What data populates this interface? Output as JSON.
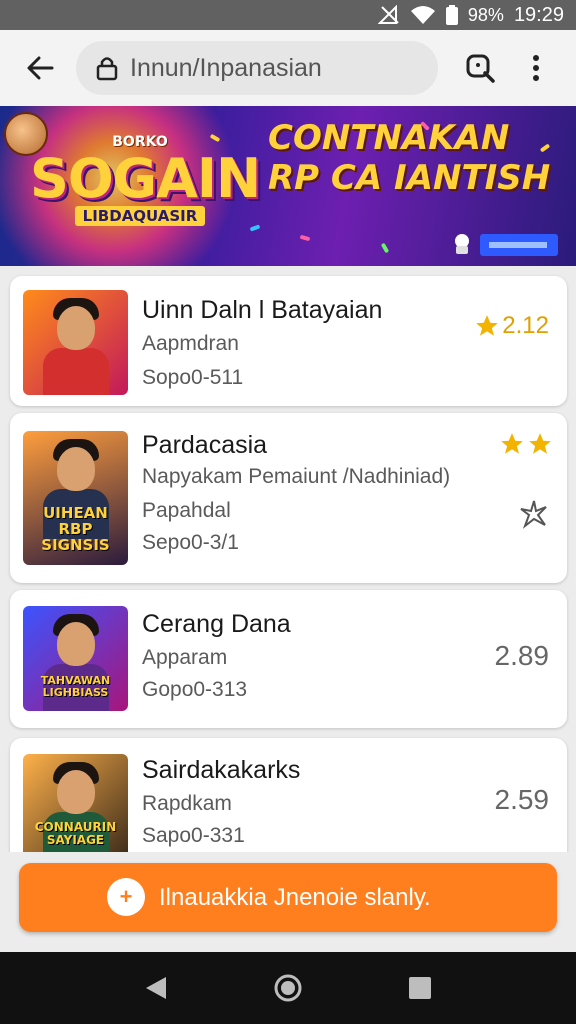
{
  "status_bar": {
    "battery": "98%",
    "time": "19:29",
    "icons": [
      "no-signal-icon",
      "wifi-icon",
      "battery-icon"
    ]
  },
  "toolbar": {
    "url": "Innun/Inpanasian",
    "icons": [
      "back-arrow-icon",
      "lock-icon",
      "search-icon",
      "more-vert-icon"
    ]
  },
  "banner": {
    "left_small": "BORKO",
    "left_big": "SOGAIN",
    "left_sub": "LIBDAQUASIR",
    "right_title": "CONTNAKAN RP CA IANTISH"
  },
  "items": [
    {
      "title": "Uinn Daln l Batayaian",
      "line1": "Aapmdran",
      "line2": "Sopo0-511",
      "rating": "2.12",
      "thumb_colors": [
        "#ff8c1a",
        "#c2185b"
      ],
      "body_color": "#d32f2f",
      "thumb_text": ""
    },
    {
      "title": "Pardacasia",
      "line1": "Napyakam Pemaiunt /Nadhiniad)",
      "line2": "Papahdal",
      "line3": "Sepo0-3/1",
      "stars": 2,
      "thumb_colors": [
        "#ff9e3d",
        "#2a1b3d"
      ],
      "body_color": "#263150",
      "thumb_text": "UIHEAN RBP SIGNSIS"
    },
    {
      "title": "Cerang Dana",
      "line1": "Apparam",
      "line2": "Gopo0-313",
      "right_value": "2.89",
      "thumb_colors": [
        "#3b54ff",
        "#a8157a"
      ],
      "body_color": "#5b2a8a",
      "thumb_text": "TAHVAWAN LIGHBIASS"
    },
    {
      "title": "Sairdakakarks",
      "line1": "Rapdkam",
      "line2": "Sapo0-331",
      "right_value": "2.59",
      "thumb_colors": [
        "#ffb14a",
        "#3a2a1a"
      ],
      "body_color": "#1f5a3a",
      "thumb_text": "CONNAURIN SAYIAGE"
    }
  ],
  "cta": {
    "label": "Ilnauakkia Jnenoie slanly.",
    "color": "#ff7f1e"
  },
  "nav": {
    "icons": [
      "back-triangle-icon",
      "home-circle-icon",
      "recents-square-icon"
    ]
  }
}
